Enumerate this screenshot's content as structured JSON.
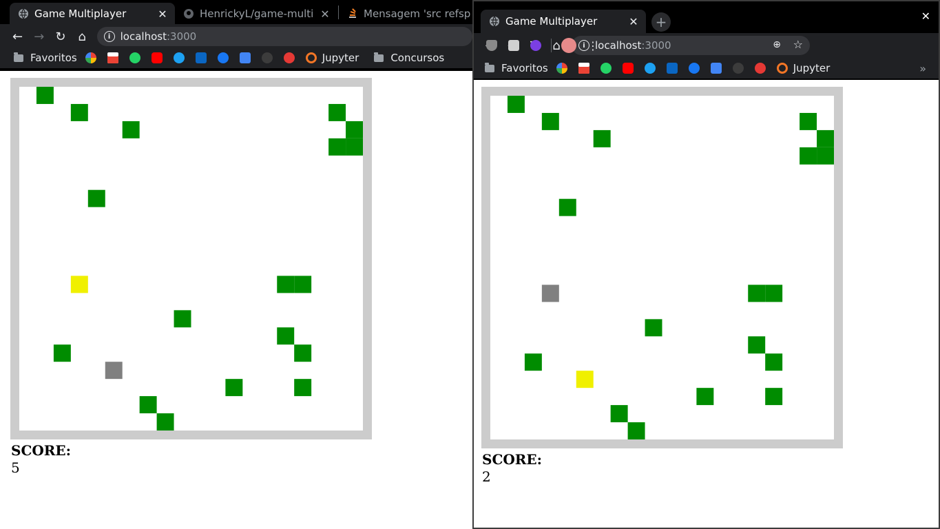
{
  "windowA": {
    "tabs": [
      {
        "title": "Game Multiplayer",
        "favicon": "globe-icon",
        "active": true
      },
      {
        "title": "HenrickyL/game-multi",
        "favicon": "github-icon",
        "active": false
      },
      {
        "title": "Mensagem 'src refsp",
        "favicon": "stackoverflow-icon",
        "active": false
      }
    ],
    "url": {
      "host": "localhost",
      "port": ":3000"
    },
    "bookmarks": [
      "Favoritos",
      "Jupyter",
      "Concursos"
    ],
    "score_label": "SCORE:",
    "score": "5"
  },
  "windowB": {
    "tabs": [
      {
        "title": "Game Multiplayer",
        "favicon": "globe-icon",
        "active": true
      }
    ],
    "new_tab": "+",
    "close": "✕",
    "url": {
      "host": "localhost",
      "port": ":3000"
    },
    "bookmarks": [
      "Favoritos",
      "Jupyter"
    ],
    "overflow": "»",
    "score_label": "SCORE:",
    "score": "2"
  },
  "colors": {
    "fruit": "#008c00",
    "current_player": "#f0f000",
    "other_player": "#808080",
    "border": "#cccccc"
  },
  "game_grid": {
    "cols": 20,
    "rows": 20
  },
  "gameA": {
    "fruits": [
      [
        1,
        0
      ],
      [
        3,
        1
      ],
      [
        6,
        2
      ],
      [
        18,
        1
      ],
      [
        19,
        2
      ],
      [
        18,
        3
      ],
      [
        19,
        3
      ],
      [
        4,
        6
      ],
      [
        15,
        11
      ],
      [
        16,
        11
      ],
      [
        9,
        13
      ],
      [
        15,
        14
      ],
      [
        16,
        15
      ],
      [
        2,
        15
      ],
      [
        12,
        17
      ],
      [
        16,
        17
      ],
      [
        7,
        18
      ],
      [
        8,
        19
      ]
    ],
    "current_player": [
      3,
      11
    ],
    "other_player": [
      5,
      16
    ]
  },
  "gameB": {
    "fruits": [
      [
        1,
        0
      ],
      [
        3,
        1
      ],
      [
        6,
        2
      ],
      [
        18,
        1
      ],
      [
        19,
        2
      ],
      [
        18,
        3
      ],
      [
        19,
        3
      ],
      [
        4,
        6
      ],
      [
        15,
        11
      ],
      [
        16,
        11
      ],
      [
        9,
        13
      ],
      [
        15,
        14
      ],
      [
        16,
        15
      ],
      [
        2,
        15
      ],
      [
        12,
        17
      ],
      [
        16,
        17
      ],
      [
        7,
        18
      ],
      [
        8,
        19
      ]
    ],
    "current_player": [
      5,
      16
    ],
    "other_player": [
      3,
      11
    ]
  }
}
